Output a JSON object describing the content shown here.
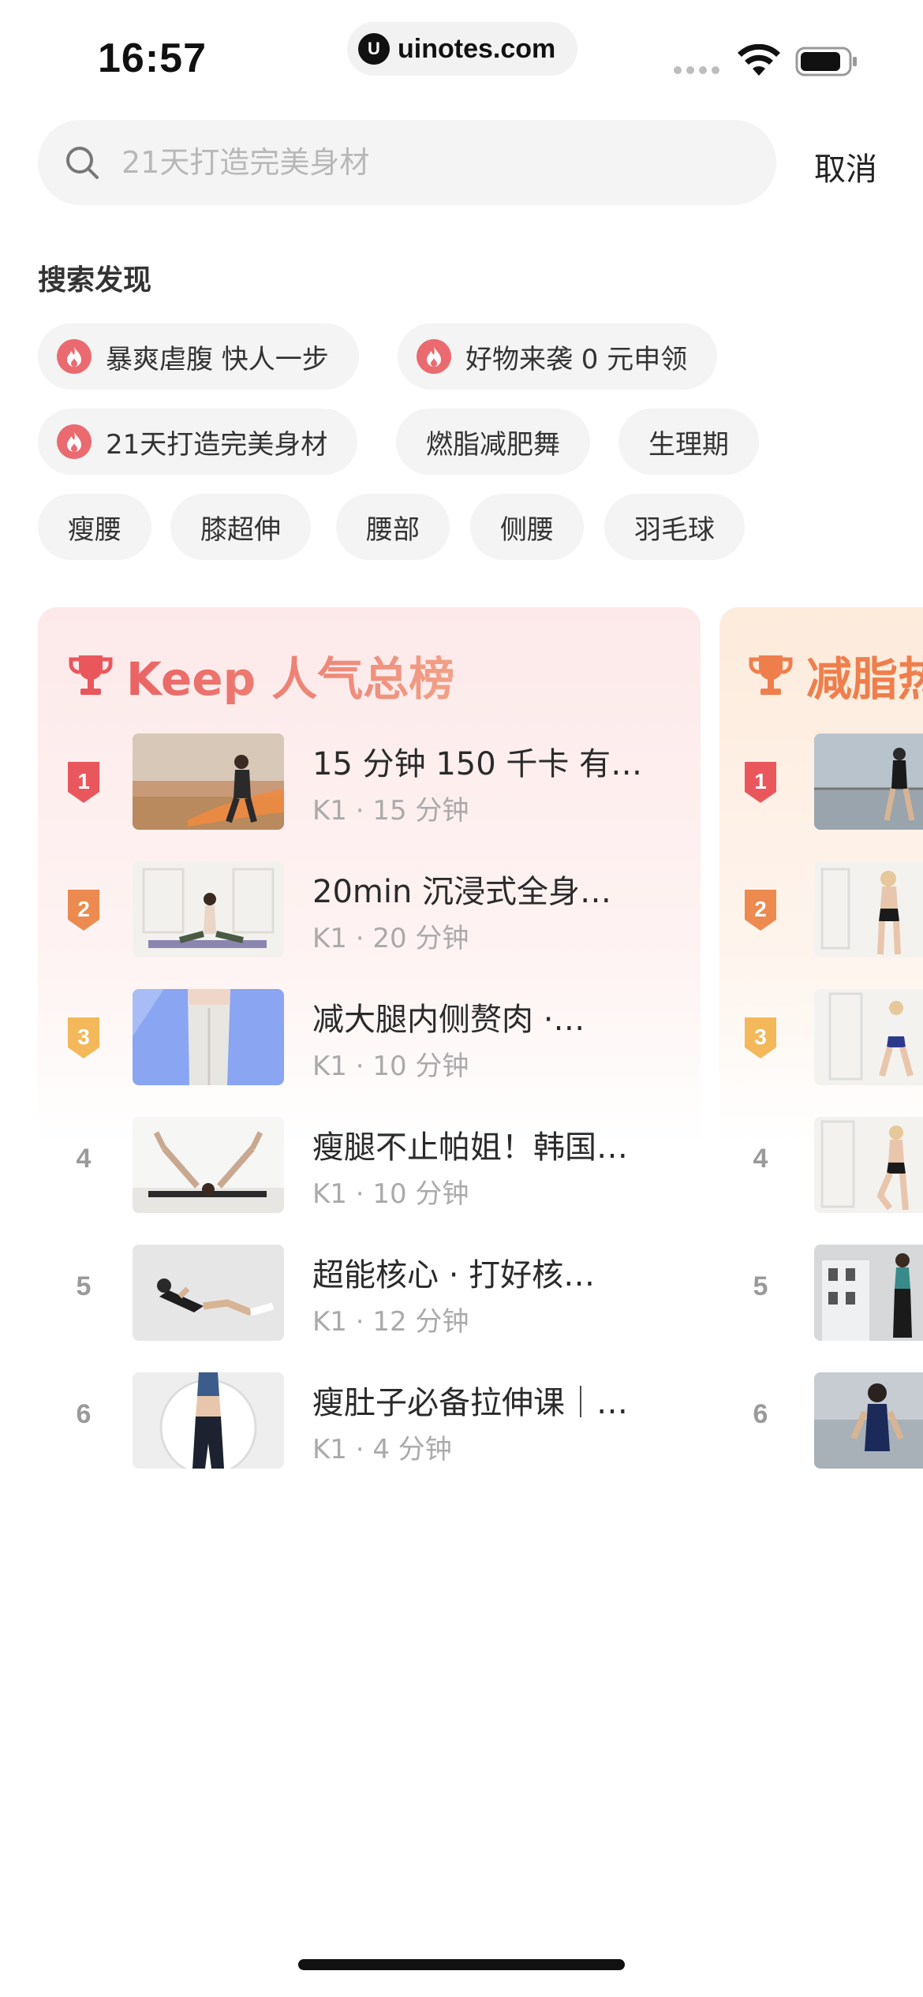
{
  "status": {
    "time": "16:57",
    "url": "uinotes.com"
  },
  "search": {
    "placeholder": "21天打造完美身材",
    "cancel_label": "取消"
  },
  "discover": {
    "title": "搜索发现",
    "chips": [
      {
        "label": "暴爽虐腹 快人一步",
        "hot": true
      },
      {
        "label": "好物来袭 0 元申领",
        "hot": true
      },
      {
        "label": "21天打造完美身材",
        "hot": true
      },
      {
        "label": "燃脂减肥舞",
        "hot": false
      },
      {
        "label": "生理期",
        "hot": false
      },
      {
        "label": "瘦腰",
        "hot": false
      },
      {
        "label": "膝超伸",
        "hot": false
      },
      {
        "label": "腰部",
        "hot": false
      },
      {
        "label": "侧腰",
        "hot": false
      },
      {
        "label": "羽毛球",
        "hot": false
      }
    ]
  },
  "rankings": [
    {
      "title": "Keep 人气总榜",
      "items": [
        {
          "rank": "1",
          "title": "15 分钟 150 千卡 有…",
          "meta": "K1 · 15 分钟"
        },
        {
          "rank": "2",
          "title": "20min 沉浸式全身…",
          "meta": "K1 · 20 分钟"
        },
        {
          "rank": "3",
          "title": "减大腿内侧赘肉 ·…",
          "meta": "K1 · 10 分钟"
        },
        {
          "rank": "4",
          "title": "瘦腿不止帕姐！韩国…",
          "meta": "K1 · 10 分钟"
        },
        {
          "rank": "5",
          "title": "超能核心 · 打好核…",
          "meta": "K1 · 12 分钟"
        },
        {
          "rank": "6",
          "title": "瘦肚子必备拉伸课｜…",
          "meta": "K1 · 4 分钟"
        }
      ]
    },
    {
      "title": "减脂热",
      "items": [
        {
          "rank": "1"
        },
        {
          "rank": "2"
        },
        {
          "rank": "3"
        },
        {
          "rank": "4"
        },
        {
          "rank": "5"
        },
        {
          "rank": "6"
        }
      ]
    }
  ],
  "colors": {
    "gold": "#e9575d",
    "silver": "#ec8a4f",
    "bronze": "#f3b85a",
    "fire": "#ea6a6f"
  }
}
